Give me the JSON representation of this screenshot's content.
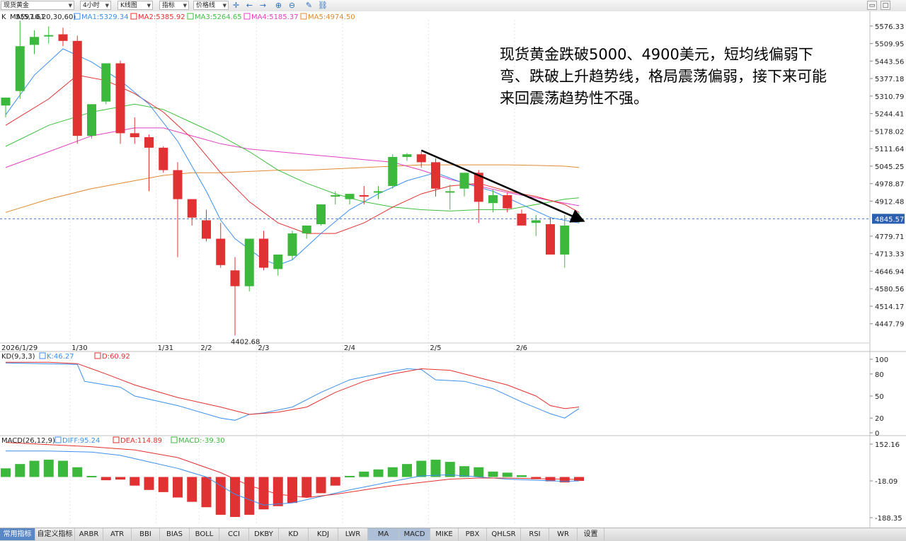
{
  "toolbar": {
    "symbol": "现货黄金",
    "period": "4小时",
    "chart_type": "K线图",
    "indicator": "指标",
    "price_line": "价格线",
    "icons": [
      "crosshair-icon",
      "arrow-left-icon",
      "arrow-right-icon",
      "arrow-right-end-icon",
      "zoom-in-icon",
      "zoom-out-icon",
      "pencil-icon",
      "link-icon"
    ]
  },
  "annotation": {
    "lines": [
      "现货黄金跌破5000、4900美元，短均线偏弱下",
      "弯、跌破上升趋势线，格局震荡偏弱，接下来可能",
      "来回震荡趋势性不强。"
    ]
  },
  "bottom_tabs": [
    "常用指标",
    "自定义指标",
    "ARBR",
    "ATR",
    "BBI",
    "BIAS",
    "BOLL",
    "CCI",
    "DKBY",
    "KD",
    "KDJ",
    "LWR",
    "MA",
    "MACD",
    "MIKE",
    "PBX",
    "QHLSR",
    "RSI",
    "WR",
    "设置"
  ],
  "chart_data": [
    {
      "type": "candlestick",
      "title": "K",
      "legend": {
        "label": "MA(5,10,20,30,60)",
        "items": [
          {
            "text": "MA1:5329.34",
            "color": "#3c8ff0"
          },
          {
            "text": "MA2:5385.92",
            "color": "#e53030"
          },
          {
            "text": "MA3:5264.65",
            "color": "#3fbf3f"
          },
          {
            "text": "MA4:5185.37",
            "color": "#e040c0"
          },
          {
            "text": "MA5:4974.50",
            "color": "#e08a30"
          }
        ]
      },
      "colors": {
        "up": "#3cb83c",
        "down": "#e03232",
        "ma1": "#3c8ff0",
        "ma2": "#e53030",
        "ma3": "#3fbf3f",
        "ma4": "#e040c0",
        "ma5": "#e08a30",
        "trendline": "#000000"
      },
      "y_ticks": [
        5576.33,
        5509.95,
        5443.56,
        5377.18,
        5310.79,
        5244.41,
        5178.02,
        5111.64,
        5045.25,
        4978.87,
        4912.48,
        4779.71,
        4713.33,
        4646.94,
        4580.56,
        4514.17,
        4447.79
      ],
      "ylim": [
        4380,
        5600
      ],
      "x_labels": [
        {
          "text": "2026/1/29",
          "index": 0
        },
        {
          "text": "1/30",
          "index": 5
        },
        {
          "text": "1/31",
          "index": 11
        },
        {
          "text": "2/2",
          "index": 14
        },
        {
          "text": "2/3",
          "index": 18
        },
        {
          "text": "2/4",
          "index": 24
        },
        {
          "text": "2/5",
          "index": 30
        },
        {
          "text": "2/6",
          "index": 36
        }
      ],
      "last_price": 4845.57,
      "max_label": 5597.61,
      "min_label": 4402.68,
      "candles": [
        {
          "o": 5275,
          "h": 5300,
          "l": 5230,
          "c": 5305
        },
        {
          "o": 5330,
          "h": 5597.61,
          "l": 5300,
          "c": 5500
        },
        {
          "o": 5505,
          "h": 5560,
          "l": 5470,
          "c": 5535
        },
        {
          "o": 5540,
          "h": 5575,
          "l": 5510,
          "c": 5542
        },
        {
          "o": 5545,
          "h": 5570,
          "l": 5500,
          "c": 5520
        },
        {
          "o": 5520,
          "h": 5540,
          "l": 5130,
          "c": 5160
        },
        {
          "o": 5160,
          "h": 5230,
          "l": 5150,
          "c": 5280
        },
        {
          "o": 5290,
          "h": 5400,
          "l": 5280,
          "c": 5435
        },
        {
          "o": 5435,
          "h": 5445,
          "l": 5130,
          "c": 5170
        },
        {
          "o": 5170,
          "h": 5230,
          "l": 5130,
          "c": 5155
        },
        {
          "o": 5155,
          "h": 5165,
          "l": 4950,
          "c": 5115
        },
        {
          "o": 5115,
          "h": 5120,
          "l": 5020,
          "c": 5030
        },
        {
          "o": 5030,
          "h": 5060,
          "l": 4700,
          "c": 4920
        },
        {
          "o": 4920,
          "h": 4920,
          "l": 4820,
          "c": 4850
        },
        {
          "o": 4840,
          "h": 4880,
          "l": 4760,
          "c": 4770
        },
        {
          "o": 4770,
          "h": 4830,
          "l": 4660,
          "c": 4670
        },
        {
          "o": 4650,
          "h": 4700,
          "l": 4402.68,
          "c": 4590
        },
        {
          "o": 4590,
          "h": 4700,
          "l": 4570,
          "c": 4770
        },
        {
          "o": 4770,
          "h": 4800,
          "l": 4650,
          "c": 4660
        },
        {
          "o": 4655,
          "h": 4700,
          "l": 4630,
          "c": 4710
        },
        {
          "o": 4705,
          "h": 4800,
          "l": 4690,
          "c": 4790
        },
        {
          "o": 4790,
          "h": 4820,
          "l": 4770,
          "c": 4820
        },
        {
          "o": 4825,
          "h": 4900,
          "l": 4820,
          "c": 4900
        },
        {
          "o": 4930,
          "h": 4950,
          "l": 4900,
          "c": 4935
        },
        {
          "o": 4920,
          "h": 4940,
          "l": 4900,
          "c": 4940
        },
        {
          "o": 4935,
          "h": 4970,
          "l": 4900,
          "c": 4930
        },
        {
          "o": 4945,
          "h": 4970,
          "l": 4920,
          "c": 4950
        },
        {
          "o": 4970,
          "h": 5090,
          "l": 4960,
          "c": 5080
        },
        {
          "o": 5080,
          "h": 5095,
          "l": 5065,
          "c": 5090
        },
        {
          "o": 5090,
          "h": 5100,
          "l": 5040,
          "c": 5060
        },
        {
          "o": 5060,
          "h": 5075,
          "l": 4930,
          "c": 4960
        },
        {
          "o": 4950,
          "h": 4975,
          "l": 4880,
          "c": 4950
        },
        {
          "o": 4960,
          "h": 5000,
          "l": 4930,
          "c": 5020
        },
        {
          "o": 5020,
          "h": 5030,
          "l": 4830,
          "c": 4910
        },
        {
          "o": 4905,
          "h": 4955,
          "l": 4870,
          "c": 4935
        },
        {
          "o": 4935,
          "h": 4945,
          "l": 4870,
          "c": 4885
        },
        {
          "o": 4865,
          "h": 4880,
          "l": 4830,
          "c": 4820
        },
        {
          "o": 4830,
          "h": 4860,
          "l": 4780,
          "c": 4840
        },
        {
          "o": 4825,
          "h": 4850,
          "l": 4710,
          "c": 4710
        },
        {
          "o": 4710,
          "h": 4860,
          "l": 4660,
          "c": 4820
        },
        {
          "o": 4835,
          "h": 4870,
          "l": 4830,
          "c": 4845.57
        }
      ],
      "ma_lines": {
        "ma1": [
          [
            0,
            5240
          ],
          [
            2,
            5390
          ],
          [
            4,
            5490
          ],
          [
            6,
            5440
          ],
          [
            8,
            5370
          ],
          [
            10,
            5280
          ],
          [
            12,
            5140
          ],
          [
            14,
            4950
          ],
          [
            15,
            4840
          ],
          [
            16,
            4770
          ],
          [
            18,
            4690
          ],
          [
            19,
            4670
          ],
          [
            20,
            4690
          ],
          [
            22,
            4790
          ],
          [
            24,
            4880
          ],
          [
            26,
            4940
          ],
          [
            28,
            4990
          ],
          [
            30,
            5020
          ],
          [
            32,
            4980
          ],
          [
            34,
            4950
          ],
          [
            36,
            4900
          ],
          [
            38,
            4850
          ],
          [
            40,
            4830
          ]
        ],
        "ma2": [
          [
            0,
            5200
          ],
          [
            3,
            5300
          ],
          [
            5,
            5390
          ],
          [
            7,
            5370
          ],
          [
            9,
            5320
          ],
          [
            11,
            5250
          ],
          [
            13,
            5150
          ],
          [
            15,
            5020
          ],
          [
            17,
            4910
          ],
          [
            19,
            4830
          ],
          [
            21,
            4790
          ],
          [
            23,
            4790
          ],
          [
            25,
            4830
          ],
          [
            27,
            4890
          ],
          [
            29,
            4940
          ],
          [
            31,
            4970
          ],
          [
            33,
            4980
          ],
          [
            35,
            4950
          ],
          [
            37,
            4930
          ],
          [
            39,
            4900
          ],
          [
            40,
            4870
          ]
        ],
        "ma3": [
          [
            0,
            5120
          ],
          [
            3,
            5200
          ],
          [
            6,
            5250
          ],
          [
            9,
            5280
          ],
          [
            11,
            5260
          ],
          [
            13,
            5210
          ],
          [
            15,
            5160
          ],
          [
            17,
            5100
          ],
          [
            19,
            5030
          ],
          [
            21,
            4980
          ],
          [
            23,
            4940
          ],
          [
            25,
            4910
          ],
          [
            27,
            4890
          ],
          [
            29,
            4880
          ],
          [
            31,
            4875
          ],
          [
            33,
            4880
          ],
          [
            35,
            4880
          ],
          [
            37,
            4900
          ],
          [
            39,
            4920
          ],
          [
            40,
            4925
          ]
        ],
        "ma4": [
          [
            0,
            5040
          ],
          [
            3,
            5100
          ],
          [
            6,
            5160
          ],
          [
            9,
            5190
          ],
          [
            11,
            5190
          ],
          [
            13,
            5160
          ],
          [
            15,
            5130
          ],
          [
            17,
            5110
          ],
          [
            19,
            5100
          ],
          [
            21,
            5090
          ],
          [
            23,
            5080
          ],
          [
            25,
            5070
          ],
          [
            27,
            5060
          ],
          [
            29,
            5030
          ],
          [
            31,
            4995
          ],
          [
            33,
            4970
          ],
          [
            35,
            4945
          ],
          [
            37,
            4925
          ],
          [
            39,
            4905
          ],
          [
            40,
            4895
          ]
        ],
        "ma5": [
          [
            0,
            4870
          ],
          [
            3,
            4920
          ],
          [
            6,
            4960
          ],
          [
            9,
            4990
          ],
          [
            11,
            5010
          ],
          [
            13,
            5020
          ],
          [
            15,
            5020
          ],
          [
            17,
            5025
          ],
          [
            19,
            5030
          ],
          [
            21,
            5030
          ],
          [
            23,
            5035
          ],
          [
            25,
            5040
          ],
          [
            27,
            5045
          ],
          [
            29,
            5050
          ],
          [
            31,
            5050
          ],
          [
            33,
            5050
          ],
          [
            35,
            5050
          ],
          [
            37,
            5048
          ],
          [
            39,
            5045
          ],
          [
            40,
            5040
          ]
        ]
      },
      "trendline": {
        "from": [
          29,
          5105
        ],
        "to": [
          40,
          4840
        ]
      }
    },
    {
      "type": "line",
      "title": "KD(9,3,3)",
      "legend": [
        {
          "text": "K:46.27",
          "color": "#3c8ff0"
        },
        {
          "text": "D:60.92",
          "color": "#e53030"
        }
      ],
      "y_ticks": [
        100,
        80,
        50,
        20,
        0
      ],
      "ylim": [
        0,
        100
      ],
      "series": [
        {
          "name": "K",
          "color": "#3c8ff0",
          "points": [
            [
              0,
              95
            ],
            [
              5,
              93
            ],
            [
              5.5,
              70
            ],
            [
              7,
              65
            ],
            [
              8,
              62
            ],
            [
              9,
              50
            ],
            [
              12,
              37
            ],
            [
              15,
              20
            ],
            [
              16,
              17
            ],
            [
              17,
              25
            ],
            [
              18,
              27
            ],
            [
              20,
              35
            ],
            [
              22,
              55
            ],
            [
              24,
              72
            ],
            [
              26,
              80
            ],
            [
              28,
              87
            ],
            [
              29,
              86
            ],
            [
              30,
              72
            ],
            [
              32,
              70
            ],
            [
              34,
              60
            ],
            [
              36,
              42
            ],
            [
              38,
              26
            ],
            [
              39,
              20
            ],
            [
              40,
              33
            ]
          ]
        },
        {
          "name": "D",
          "color": "#e53030",
          "points": [
            [
              0,
              96
            ],
            [
              3,
              96
            ],
            [
              5,
              94
            ],
            [
              7,
              80
            ],
            [
              9,
              65
            ],
            [
              12,
              48
            ],
            [
              15,
              35
            ],
            [
              17,
              25
            ],
            [
              19,
              28
            ],
            [
              21,
              35
            ],
            [
              23,
              55
            ],
            [
              25,
              70
            ],
            [
              27,
              80
            ],
            [
              29,
              87
            ],
            [
              31,
              85
            ],
            [
              33,
              75
            ],
            [
              35,
              65
            ],
            [
              37,
              50
            ],
            [
              38,
              37
            ],
            [
              39,
              33
            ],
            [
              40,
              35
            ]
          ]
        }
      ]
    },
    {
      "type": "bar",
      "title": "MACD(26,12,9)",
      "legend": [
        {
          "text": "DIFF:95.24",
          "color": "#3c8ff0"
        },
        {
          "text": "DEA:114.89",
          "color": "#e53030"
        },
        {
          "text": "MACD:-39.30",
          "color": "#3cb83c"
        }
      ],
      "y_ticks": [
        152.16,
        -18.09,
        -188.35
      ],
      "ylim": [
        -188.35,
        152.16
      ],
      "macd": [
        40,
        60,
        75,
        80,
        75,
        45,
        5,
        -15,
        -12,
        -40,
        -60,
        -70,
        -95,
        -115,
        -140,
        -175,
        -185,
        -175,
        -150,
        -135,
        -120,
        -95,
        -75,
        -40,
        5,
        25,
        35,
        45,
        60,
        75,
        80,
        70,
        50,
        45,
        25,
        20,
        8,
        -10,
        -20,
        -25,
        -18
      ],
      "diff": [
        [
          0,
          120
        ],
        [
          3,
          120
        ],
        [
          6,
          115
        ],
        [
          8,
          100
        ],
        [
          10,
          70
        ],
        [
          12,
          40
        ],
        [
          14,
          0
        ],
        [
          16,
          -80
        ],
        [
          18,
          -130
        ],
        [
          20,
          -120
        ],
        [
          22,
          -90
        ],
        [
          24,
          -60
        ],
        [
          27,
          -20
        ],
        [
          29,
          5
        ],
        [
          31,
          10
        ],
        [
          33,
          0
        ],
        [
          35,
          -10
        ],
        [
          37,
          -15
        ],
        [
          39,
          -20
        ],
        [
          40,
          -18
        ]
      ],
      "dea": [
        [
          0,
          160
        ],
        [
          3,
          150
        ],
        [
          6,
          140
        ],
        [
          9,
          125
        ],
        [
          12,
          90
        ],
        [
          15,
          20
        ],
        [
          17,
          -40
        ],
        [
          19,
          -80
        ],
        [
          21,
          -95
        ],
        [
          23,
          -80
        ],
        [
          25,
          -60
        ],
        [
          27,
          -40
        ],
        [
          29,
          -25
        ],
        [
          31,
          -10
        ],
        [
          33,
          -5
        ],
        [
          35,
          -5
        ],
        [
          37,
          -8
        ],
        [
          39,
          -10
        ],
        [
          40,
          -12
        ]
      ]
    }
  ]
}
